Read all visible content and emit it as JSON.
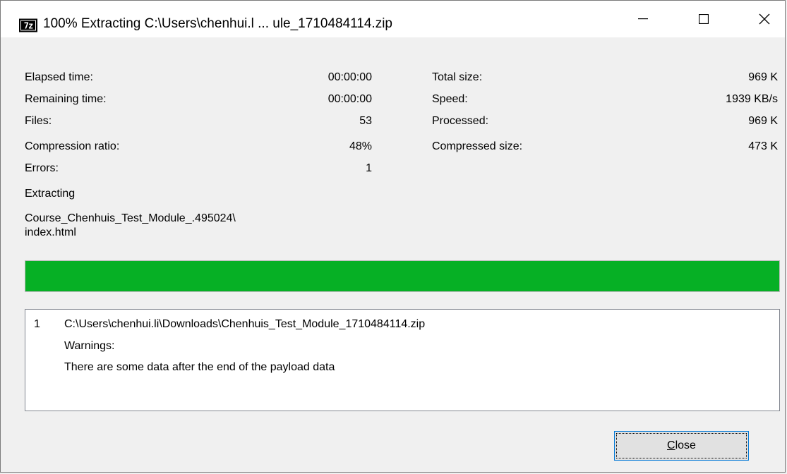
{
  "window": {
    "title": "100% Extracting C:\\Users\\chenhui.l ... ule_1710484114.zip",
    "icon": "7z"
  },
  "stats_left": [
    {
      "label": "Elapsed time:",
      "value": "00:00:00"
    },
    {
      "label": "Remaining time:",
      "value": "00:00:00"
    },
    {
      "label": "Files:",
      "value": "53"
    },
    {
      "label": "Compression ratio:",
      "value": "48%"
    },
    {
      "label": "Errors:",
      "value": "1"
    }
  ],
  "stats_right": [
    {
      "label": "Total size:",
      "value": "969 K"
    },
    {
      "label": "Speed:",
      "value": "1939 KB/s"
    },
    {
      "label": "Processed:",
      "value": "969 K"
    },
    {
      "label": "Compressed size:",
      "value": "473 K"
    }
  ],
  "extracting_label": "Extracting",
  "current_path_line1": "Course_Chenhuis_Test_Module_.495024\\",
  "current_path_line2": "index.html",
  "progress": {
    "percent": 100,
    "color": "#06b025"
  },
  "log": {
    "number": "1",
    "lines": [
      "C:\\Users\\chenhui.li\\Downloads\\Chenhuis_Test_Module_1710484114.zip",
      "Warnings:",
      "There are some data after the end of the payload data"
    ]
  },
  "close_button": {
    "label_underlined": "C",
    "label_rest": "lose"
  }
}
